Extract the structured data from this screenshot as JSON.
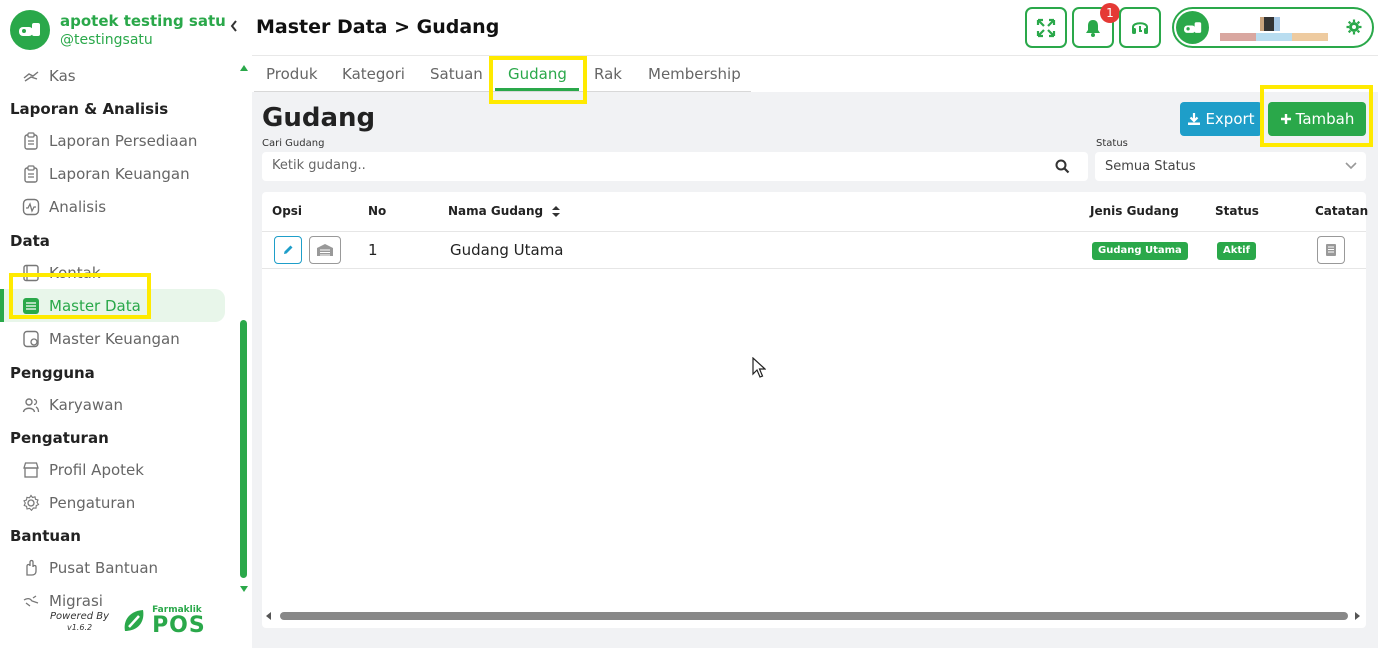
{
  "brand": {
    "name": "apotek testing satu",
    "handle": "@testingsatu"
  },
  "sidebar": {
    "items_top": [
      {
        "label": "Kas",
        "icon": "cash-icon"
      }
    ],
    "sections": [
      {
        "title": "Laporan & Analisis",
        "items": [
          {
            "label": "Laporan Persediaan",
            "icon": "clipboard-icon"
          },
          {
            "label": "Laporan Keuangan",
            "icon": "clipboard-icon"
          },
          {
            "label": "Analisis",
            "icon": "analytics-icon"
          }
        ]
      },
      {
        "title": "Data",
        "items": [
          {
            "label": "Kontak",
            "icon": "contact-book-icon"
          },
          {
            "label": "Master Data",
            "icon": "database-icon",
            "active": true
          },
          {
            "label": "Master Keuangan",
            "icon": "finance-icon"
          }
        ]
      },
      {
        "title": "Pengguna",
        "items": [
          {
            "label": "Karyawan",
            "icon": "users-icon"
          }
        ]
      },
      {
        "title": "Pengaturan",
        "items": [
          {
            "label": "Profil Apotek",
            "icon": "store-icon"
          },
          {
            "label": "Pengaturan",
            "icon": "gear-icon"
          }
        ]
      },
      {
        "title": "Bantuan",
        "items": [
          {
            "label": "Pusat Bantuan",
            "icon": "help-hand-icon"
          },
          {
            "label": "Migrasi",
            "icon": "migrate-icon"
          }
        ]
      }
    ],
    "powered_by": "Powered By",
    "version": "v1.6.2",
    "pos_brand_small": "Farmaklik",
    "pos_brand_big": "POS"
  },
  "header": {
    "title": "Master Data > Gudang",
    "notification_count": "1"
  },
  "tabs": [
    {
      "label": "Produk"
    },
    {
      "label": "Kategori"
    },
    {
      "label": "Satuan"
    },
    {
      "label": "Gudang",
      "active": true
    },
    {
      "label": "Rak"
    },
    {
      "label": "Membership"
    }
  ],
  "main": {
    "title": "Gudang",
    "export_label": "Export",
    "add_label": "Tambah",
    "search_label": "Cari Gudang",
    "search_placeholder": "Ketik gudang..",
    "status_label": "Status",
    "status_value": "Semua Status"
  },
  "table": {
    "columns": [
      "Opsi",
      "No",
      "Nama Gudang",
      "Jenis Gudang",
      "Status",
      "Catatan"
    ],
    "rows": [
      {
        "no": "1",
        "name": "Gudang Utama",
        "type": "Gudang Utama",
        "status": "Aktif"
      }
    ]
  },
  "colors": {
    "primary": "#2aa84a",
    "export": "#1e9ec9",
    "highlight": "#ffea00",
    "badge_notification": "#e53935"
  }
}
